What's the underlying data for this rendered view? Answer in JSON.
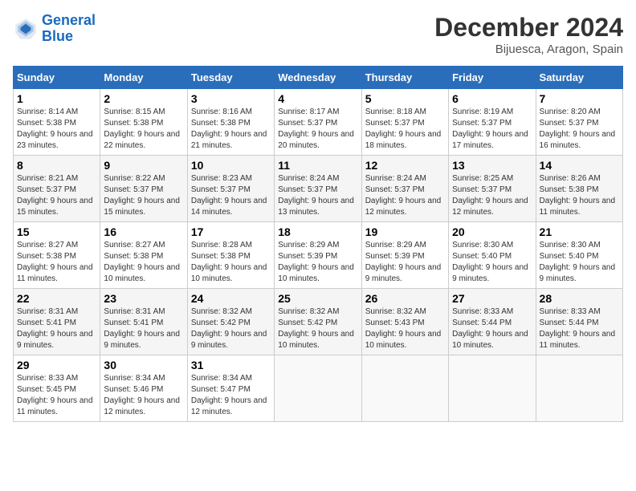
{
  "header": {
    "logo_line1": "General",
    "logo_line2": "Blue",
    "month_title": "December 2024",
    "location": "Bijuesca, Aragon, Spain"
  },
  "weekdays": [
    "Sunday",
    "Monday",
    "Tuesday",
    "Wednesday",
    "Thursday",
    "Friday",
    "Saturday"
  ],
  "weeks": [
    [
      {
        "day": "1",
        "sunrise": "8:14 AM",
        "sunset": "5:38 PM",
        "daylight": "9 hours and 23 minutes."
      },
      {
        "day": "2",
        "sunrise": "8:15 AM",
        "sunset": "5:38 PM",
        "daylight": "9 hours and 22 minutes."
      },
      {
        "day": "3",
        "sunrise": "8:16 AM",
        "sunset": "5:38 PM",
        "daylight": "9 hours and 21 minutes."
      },
      {
        "day": "4",
        "sunrise": "8:17 AM",
        "sunset": "5:37 PM",
        "daylight": "9 hours and 20 minutes."
      },
      {
        "day": "5",
        "sunrise": "8:18 AM",
        "sunset": "5:37 PM",
        "daylight": "9 hours and 18 minutes."
      },
      {
        "day": "6",
        "sunrise": "8:19 AM",
        "sunset": "5:37 PM",
        "daylight": "9 hours and 17 minutes."
      },
      {
        "day": "7",
        "sunrise": "8:20 AM",
        "sunset": "5:37 PM",
        "daylight": "9 hours and 16 minutes."
      }
    ],
    [
      {
        "day": "8",
        "sunrise": "8:21 AM",
        "sunset": "5:37 PM",
        "daylight": "9 hours and 15 minutes."
      },
      {
        "day": "9",
        "sunrise": "8:22 AM",
        "sunset": "5:37 PM",
        "daylight": "9 hours and 15 minutes."
      },
      {
        "day": "10",
        "sunrise": "8:23 AM",
        "sunset": "5:37 PM",
        "daylight": "9 hours and 14 minutes."
      },
      {
        "day": "11",
        "sunrise": "8:24 AM",
        "sunset": "5:37 PM",
        "daylight": "9 hours and 13 minutes."
      },
      {
        "day": "12",
        "sunrise": "8:24 AM",
        "sunset": "5:37 PM",
        "daylight": "9 hours and 12 minutes."
      },
      {
        "day": "13",
        "sunrise": "8:25 AM",
        "sunset": "5:37 PM",
        "daylight": "9 hours and 12 minutes."
      },
      {
        "day": "14",
        "sunrise": "8:26 AM",
        "sunset": "5:38 PM",
        "daylight": "9 hours and 11 minutes."
      }
    ],
    [
      {
        "day": "15",
        "sunrise": "8:27 AM",
        "sunset": "5:38 PM",
        "daylight": "9 hours and 11 minutes."
      },
      {
        "day": "16",
        "sunrise": "8:27 AM",
        "sunset": "5:38 PM",
        "daylight": "9 hours and 10 minutes."
      },
      {
        "day": "17",
        "sunrise": "8:28 AM",
        "sunset": "5:38 PM",
        "daylight": "9 hours and 10 minutes."
      },
      {
        "day": "18",
        "sunrise": "8:29 AM",
        "sunset": "5:39 PM",
        "daylight": "9 hours and 10 minutes."
      },
      {
        "day": "19",
        "sunrise": "8:29 AM",
        "sunset": "5:39 PM",
        "daylight": "9 hours and 9 minutes."
      },
      {
        "day": "20",
        "sunrise": "8:30 AM",
        "sunset": "5:40 PM",
        "daylight": "9 hours and 9 minutes."
      },
      {
        "day": "21",
        "sunrise": "8:30 AM",
        "sunset": "5:40 PM",
        "daylight": "9 hours and 9 minutes."
      }
    ],
    [
      {
        "day": "22",
        "sunrise": "8:31 AM",
        "sunset": "5:41 PM",
        "daylight": "9 hours and 9 minutes."
      },
      {
        "day": "23",
        "sunrise": "8:31 AM",
        "sunset": "5:41 PM",
        "daylight": "9 hours and 9 minutes."
      },
      {
        "day": "24",
        "sunrise": "8:32 AM",
        "sunset": "5:42 PM",
        "daylight": "9 hours and 9 minutes."
      },
      {
        "day": "25",
        "sunrise": "8:32 AM",
        "sunset": "5:42 PM",
        "daylight": "9 hours and 10 minutes."
      },
      {
        "day": "26",
        "sunrise": "8:32 AM",
        "sunset": "5:43 PM",
        "daylight": "9 hours and 10 minutes."
      },
      {
        "day": "27",
        "sunrise": "8:33 AM",
        "sunset": "5:44 PM",
        "daylight": "9 hours and 10 minutes."
      },
      {
        "day": "28",
        "sunrise": "8:33 AM",
        "sunset": "5:44 PM",
        "daylight": "9 hours and 11 minutes."
      }
    ],
    [
      {
        "day": "29",
        "sunrise": "8:33 AM",
        "sunset": "5:45 PM",
        "daylight": "9 hours and 11 minutes."
      },
      {
        "day": "30",
        "sunrise": "8:34 AM",
        "sunset": "5:46 PM",
        "daylight": "9 hours and 12 minutes."
      },
      {
        "day": "31",
        "sunrise": "8:34 AM",
        "sunset": "5:47 PM",
        "daylight": "9 hours and 12 minutes."
      },
      null,
      null,
      null,
      null
    ]
  ]
}
